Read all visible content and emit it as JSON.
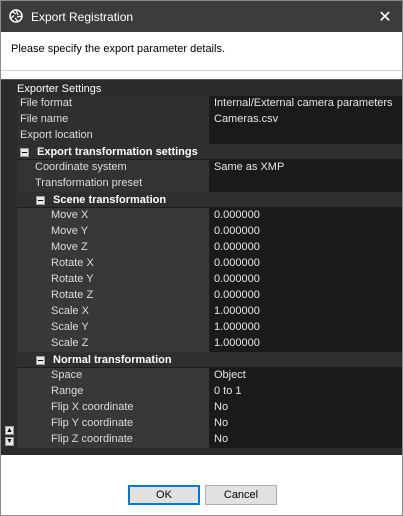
{
  "window": {
    "title": "Export Registration",
    "close_glyph": "✕",
    "app_icon": "camera-aperture-icon"
  },
  "instruction": "Please specify the export parameter details.",
  "panel": {
    "header": "Exporter Settings",
    "rows": [
      {
        "name": "File format",
        "value": "Internal/External camera parameters"
      },
      {
        "name": "File name",
        "value": "Cameras.csv"
      },
      {
        "name": "Export location",
        "value": ""
      }
    ],
    "transformation": {
      "label": "Export transformation settings",
      "rows": [
        {
          "name": "Coordinate system",
          "value": "Same as XMP"
        },
        {
          "name": "Transformation preset",
          "value": ""
        }
      ],
      "scene": {
        "label": "Scene transformation",
        "rows": [
          {
            "name": "Move X",
            "value": "0.000000"
          },
          {
            "name": "Move Y",
            "value": "0.000000"
          },
          {
            "name": "Move Z",
            "value": "0.000000"
          },
          {
            "name": "Rotate X",
            "value": "0.000000"
          },
          {
            "name": "Rotate Y",
            "value": "0.000000"
          },
          {
            "name": "Rotate Z",
            "value": "0.000000"
          },
          {
            "name": "Scale X",
            "value": "1.000000"
          },
          {
            "name": "Scale Y",
            "value": "1.000000"
          },
          {
            "name": "Scale Z",
            "value": "1.000000"
          }
        ]
      },
      "normal": {
        "label": "Normal transformation",
        "rows": [
          {
            "name": "Space",
            "value": "Object"
          },
          {
            "name": "Range",
            "value": "0 to 1"
          },
          {
            "name": "Flip X coordinate",
            "value": "No"
          },
          {
            "name": "Flip Y coordinate",
            "value": "No"
          },
          {
            "name": "Flip Z coordinate",
            "value": "No"
          }
        ]
      }
    }
  },
  "buttons": {
    "ok": "OK",
    "cancel": "Cancel"
  }
}
